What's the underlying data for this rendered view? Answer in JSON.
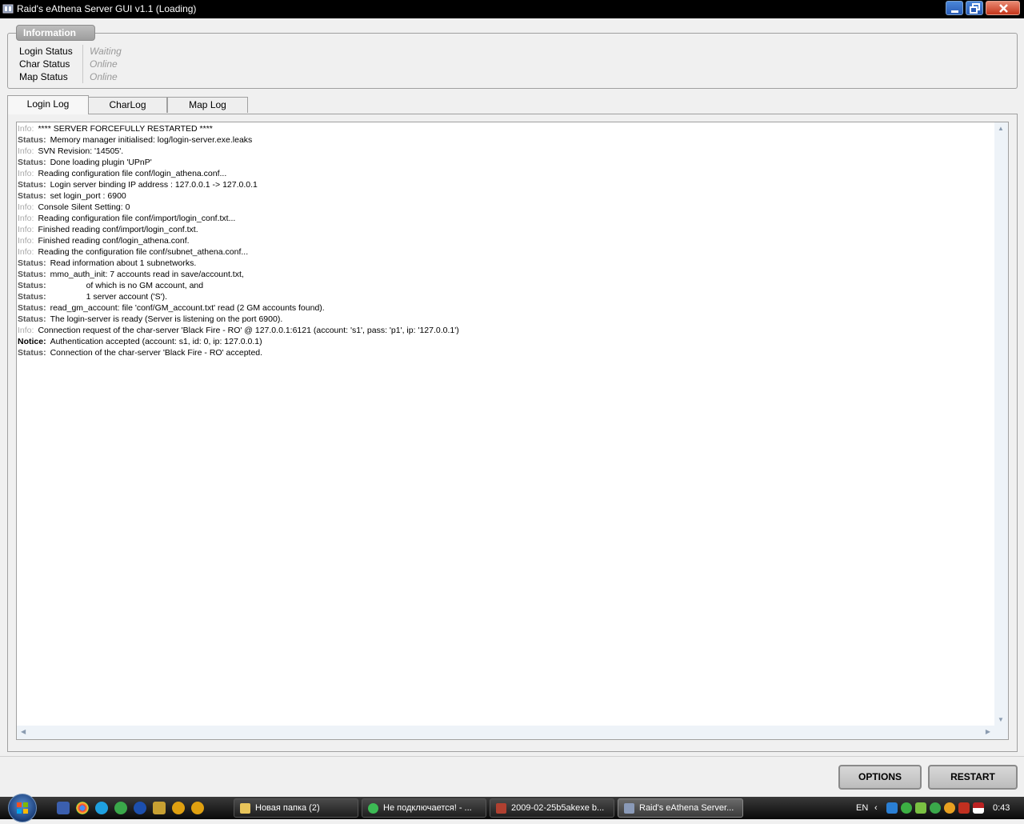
{
  "window": {
    "title": "Raid's eAthena Server GUI v1.1 (Loading)"
  },
  "info": {
    "legend": "Information",
    "rows": [
      {
        "label": "Login Status",
        "value": "Waiting"
      },
      {
        "label": "Char Status",
        "value": "Online"
      },
      {
        "label": "Map Status",
        "value": "Online"
      }
    ]
  },
  "tabs": [
    {
      "label": "Login Log",
      "active": true
    },
    {
      "label": "CharLog",
      "active": false
    },
    {
      "label": "Map Log",
      "active": false
    }
  ],
  "log": [
    {
      "level": "Info:",
      "type": "info",
      "text": "**** SERVER FORCEFULLY RESTARTED ****"
    },
    {
      "level": "Status:",
      "type": "status",
      "text": "Memory manager initialised: log/login-server.exe.leaks"
    },
    {
      "level": "Info:",
      "type": "info",
      "text": "SVN Revision: '14505'."
    },
    {
      "level": "Status:",
      "type": "status",
      "text": "Done loading plugin 'UPnP'"
    },
    {
      "level": "Info:",
      "type": "info",
      "text": "Reading configuration file conf/login_athena.conf..."
    },
    {
      "level": "Status:",
      "type": "status",
      "text": "Login server binding IP address : 127.0.0.1 -> 127.0.0.1"
    },
    {
      "level": "Status:",
      "type": "status",
      "text": "set login_port : 6900"
    },
    {
      "level": "Info:",
      "type": "info",
      "text": "Console Silent Setting: 0"
    },
    {
      "level": "Info:",
      "type": "info",
      "text": "Reading configuration file conf/import/login_conf.txt..."
    },
    {
      "level": "Info:",
      "type": "info",
      "text": "Finished reading conf/import/login_conf.txt."
    },
    {
      "level": "Info:",
      "type": "info",
      "text": "Finished reading conf/login_athena.conf."
    },
    {
      "level": "Info:",
      "type": "info",
      "text": "Reading the configuration file conf/subnet_athena.conf..."
    },
    {
      "level": "Status:",
      "type": "status",
      "text": "Read information about 1 subnetworks."
    },
    {
      "level": "Status:",
      "type": "status",
      "text": "mmo_auth_init: 7 accounts read in save/account.txt,"
    },
    {
      "level": "Status:",
      "type": "status",
      "text": "of which is no GM account, and",
      "indent": true
    },
    {
      "level": "Status:",
      "type": "status",
      "text": "1 server account ('S').",
      "indent": true
    },
    {
      "level": "Status:",
      "type": "status",
      "text": "read_gm_account: file 'conf/GM_account.txt' read (2 GM accounts found)."
    },
    {
      "level": "Status:",
      "type": "status",
      "text": "The login-server is ready (Server is listening on the port 6900)."
    },
    {
      "level": "Info:",
      "type": "info",
      "text": "Connection request of the char-server 'Black Fire - RO' @ 127.0.0.1:6121 (account: 's1', pass: 'p1', ip: '127.0.0.1')"
    },
    {
      "level": "Notice:",
      "type": "notice",
      "text": "Authentication accepted (account: s1, id: 0, ip: 127.0.0.1)"
    },
    {
      "level": "Status:",
      "type": "status",
      "text": "Connection of the char-server 'Black Fire - RO' accepted."
    }
  ],
  "buttons": {
    "options": "OPTIONS",
    "restart": "RESTART"
  },
  "taskbar": {
    "tasks": [
      {
        "label": "Новая папка (2)",
        "icon_color": "#e8c45a"
      },
      {
        "label": "Не подключается! - ...",
        "icon_color": "#3cba54"
      },
      {
        "label": "2009-02-25b5akexe b...",
        "icon_color": "#b04030"
      },
      {
        "label": "Raid's eAthena Server...",
        "icon_color": "#8a9ab8"
      }
    ],
    "language": "EN",
    "clock": "0:43"
  },
  "colors": {
    "info_level": "#a8a8a8",
    "status_level": "#555555",
    "notice_level": "#000000"
  }
}
